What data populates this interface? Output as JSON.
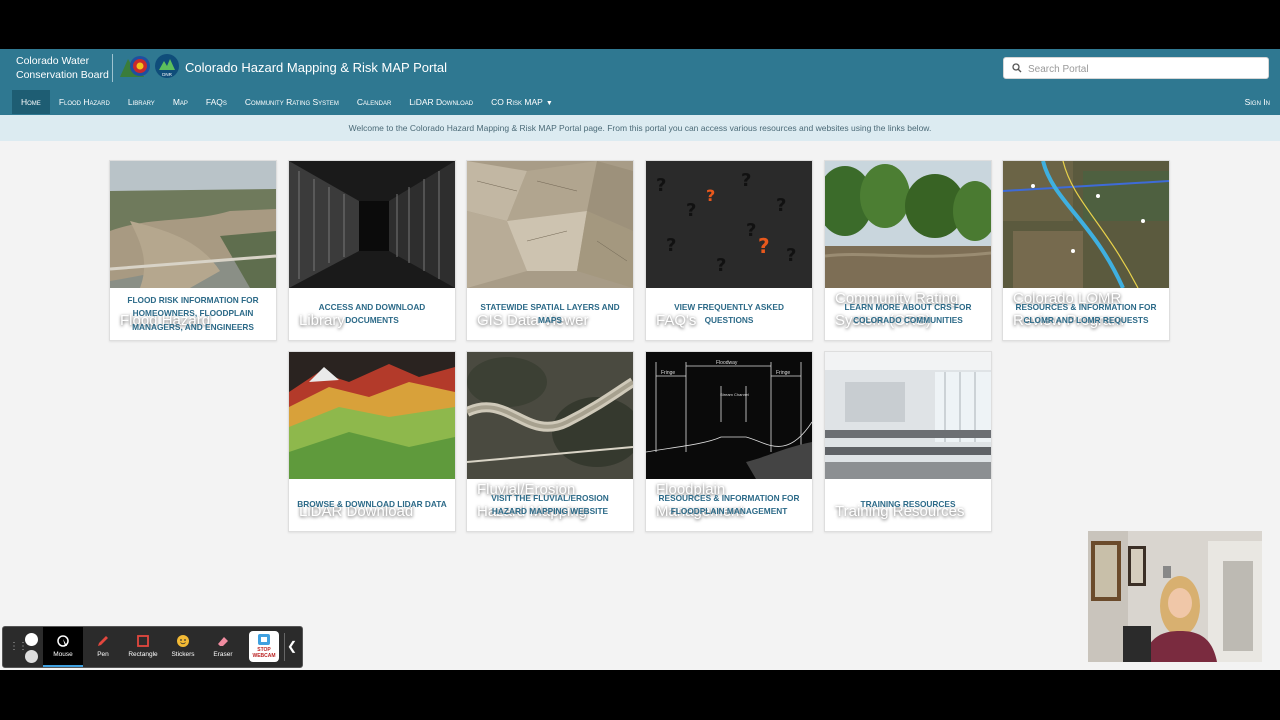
{
  "header": {
    "org_line1": "Colorado Water",
    "org_line2": "Conservation Board",
    "portal_title": "Colorado Hazard Mapping & Risk MAP Portal",
    "search_placeholder": "Search Portal"
  },
  "nav": {
    "items": [
      {
        "label": "Home",
        "active": true
      },
      {
        "label": "Flood Hazard"
      },
      {
        "label": "Library"
      },
      {
        "label": "Map"
      },
      {
        "label": "FAQs"
      },
      {
        "label": "Community Rating System"
      },
      {
        "label": "Calendar"
      },
      {
        "label": "LiDAR Download"
      },
      {
        "label": "CO Risk MAP"
      }
    ],
    "sign_in": "Sign In"
  },
  "welcome": "Welcome to the Colorado Hazard Mapping & Risk MAP Portal page. From this portal you can access various resources and websites using the links below.",
  "tiles": [
    {
      "title": "Flood Hazard",
      "description": "FLOOD RISK INFORMATION FOR HOMEOWNERS, FLOODPLAIN MANAGERS, AND ENGINEERS"
    },
    {
      "title": "Library",
      "description": "ACCESS AND DOWNLOAD DOCUMENTS"
    },
    {
      "title": "GIS Data Viewer",
      "description": "STATEWIDE SPATIAL LAYERS AND MAPS"
    },
    {
      "title": "FAQ's",
      "description": "VIEW FREQUENTLY ASKED QUESTIONS"
    },
    {
      "title": "Community Rating System (CRS)",
      "description": "LEARN MORE ABOUT CRS FOR COLORADO COMMUNITIES"
    },
    {
      "title": "Colorado LOMR Review Program",
      "description": "RESOURCES & INFORMATION FOR CLOMR AND LOMR REQUESTS"
    },
    {
      "title": "LiDAR Download",
      "description": "BROWSE & DOWNLOAD LIDAR DATA"
    },
    {
      "title": "Fluvial/Erosion Hazard Mapping",
      "description": "VISIT THE FLUVIAL/EROSION HAZARD MAPPING WEBSITE"
    },
    {
      "title": "Floodplain Management",
      "description": "RESOURCES & INFORMATION FOR FLOODPLAIN MANAGEMENT"
    },
    {
      "title": "Training Resources",
      "description": "TRAINING RESOURCES"
    }
  ],
  "floodway_labels": {
    "fringe": "Fringe",
    "floodway": "Floodway",
    "stream_channel": "Stream Channel"
  },
  "toolbar": {
    "tools": [
      "Mouse",
      "Pen",
      "Rectangle",
      "Stickers",
      "Eraser"
    ],
    "webcam_label": "STOP WEBCAM"
  },
  "colors": {
    "header": "#2f7891",
    "nav_active": "#1e5d73",
    "welcome_bar": "#dcebf1",
    "tile_text": "#2c6a88"
  }
}
